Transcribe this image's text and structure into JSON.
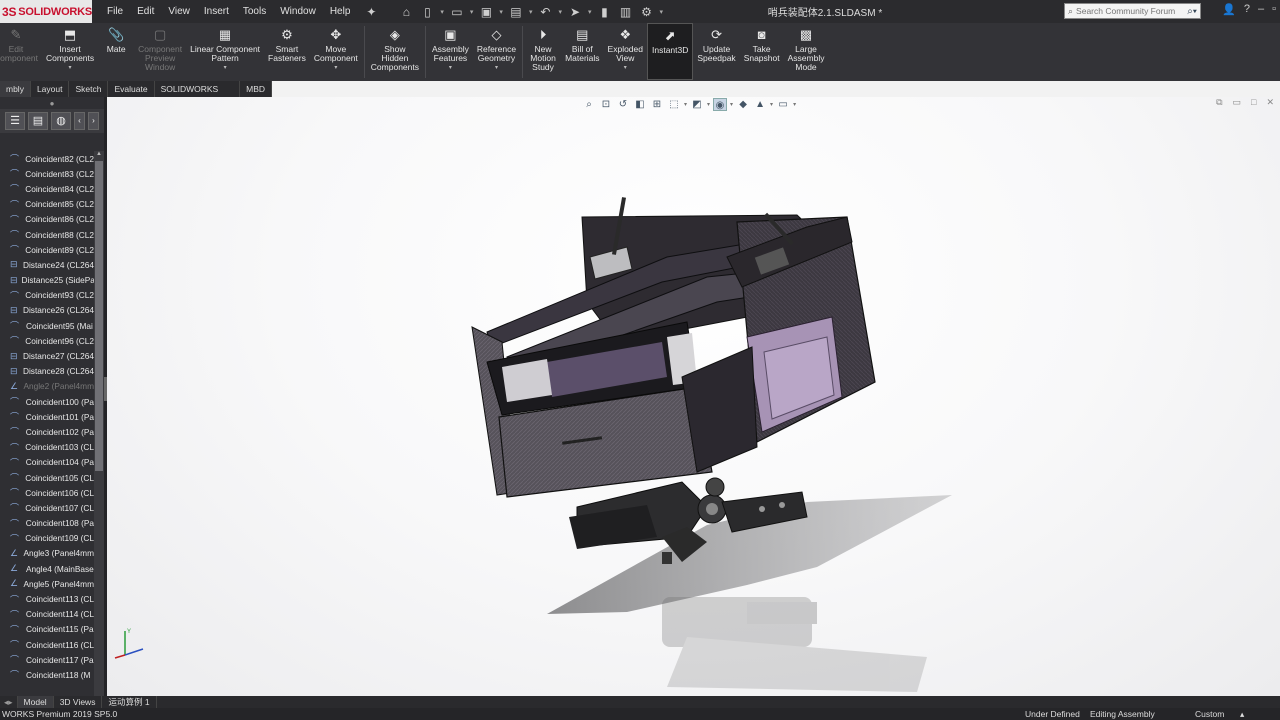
{
  "app": {
    "logo_text": "SOLIDWORKS",
    "document_title": "哨兵装配体2.1.SLDASM *"
  },
  "menu": [
    "File",
    "Edit",
    "View",
    "Insert",
    "Tools",
    "Window",
    "Help"
  ],
  "search": {
    "placeholder": "Search Community Forum"
  },
  "command_manager": {
    "edit_component": "Edit\nComponent",
    "insert_components": "Insert\nComponents",
    "mate": "Mate",
    "component_preview": "Component\nPreview\nWindow",
    "linear_pattern": "Linear Component\nPattern",
    "smart_fasteners": "Smart\nFasteners",
    "move_component": "Move\nComponent",
    "show_hidden": "Show\nHidden\nComponents",
    "assembly_features": "Assembly\nFeatures",
    "reference_geometry": "Reference\nGeometry",
    "new_motion_study": "New\nMotion\nStudy",
    "bill_of_materials": "Bill of\nMaterials",
    "exploded_view": "Exploded\nView",
    "instant3d": "Instant3D",
    "update_speedpak": "Update\nSpeedpak",
    "take_snapshot": "Take\nSnapshot",
    "large_assembly_mode": "Large\nAssembly\nMode"
  },
  "tabs": [
    "mbly",
    "Layout",
    "Sketch",
    "Evaluate",
    "SOLIDWORKS Add-Ins",
    "MBD"
  ],
  "tree": [
    {
      "label": "Coincident82 (CL2",
      "suppressed": false
    },
    {
      "label": "Coincident83 (CL2",
      "suppressed": false
    },
    {
      "label": "Coincident84 (CL2",
      "suppressed": false
    },
    {
      "label": "Coincident85 (CL2",
      "suppressed": false
    },
    {
      "label": "Coincident86 (CL2",
      "suppressed": false
    },
    {
      "label": "Coincident88 (CL2",
      "suppressed": false
    },
    {
      "label": "Coincident89 (CL2",
      "suppressed": false
    },
    {
      "label": "Distance24 (CL264",
      "suppressed": false
    },
    {
      "label": "Distance25 (SidePa",
      "suppressed": false
    },
    {
      "label": "Coincident93 (CL2",
      "suppressed": false
    },
    {
      "label": "Distance26 (CL264",
      "suppressed": false
    },
    {
      "label": "Coincident95 (Mai",
      "suppressed": false
    },
    {
      "label": "Coincident96 (CL2",
      "suppressed": false
    },
    {
      "label": "Distance27 (CL264",
      "suppressed": false
    },
    {
      "label": "Distance28 (CL264",
      "suppressed": false
    },
    {
      "label": "Angle2 (Panel4mm",
      "suppressed": true
    },
    {
      "label": "Coincident100 (Pa",
      "suppressed": false
    },
    {
      "label": "Coincident101 (Pa",
      "suppressed": false
    },
    {
      "label": "Coincident102 (Pa",
      "suppressed": false
    },
    {
      "label": "Coincident103 (CL",
      "suppressed": false
    },
    {
      "label": "Coincident104 (Pa",
      "suppressed": false
    },
    {
      "label": "Coincident105 (CL",
      "suppressed": false
    },
    {
      "label": "Coincident106 (CL",
      "suppressed": false
    },
    {
      "label": "Coincident107 (CL",
      "suppressed": false
    },
    {
      "label": "Coincident108 (Pa",
      "suppressed": false
    },
    {
      "label": "Coincident109 (CL",
      "suppressed": false
    },
    {
      "label": "Angle3 (Panel4mm",
      "suppressed": false
    },
    {
      "label": "Angle4 (MainBase",
      "suppressed": false
    },
    {
      "label": "Angle5 (Panel4mm",
      "suppressed": false
    },
    {
      "label": "Coincident113 (CL",
      "suppressed": false
    },
    {
      "label": "Coincident114 (CL",
      "suppressed": false
    },
    {
      "label": "Coincident115 (Pa",
      "suppressed": false
    },
    {
      "label": "Coincident116 (CL",
      "suppressed": false
    },
    {
      "label": "Coincident117 (Pa",
      "suppressed": false
    },
    {
      "label": "Coincident118 (M",
      "suppressed": false
    }
  ],
  "bottom_tabs": [
    "Model",
    "3D Views",
    "运动算例 1"
  ],
  "status": {
    "product": "WORKS Premium 2019 SP5.0",
    "definition": "Under Defined",
    "mode": "Editing Assembly",
    "units": "Custom"
  }
}
